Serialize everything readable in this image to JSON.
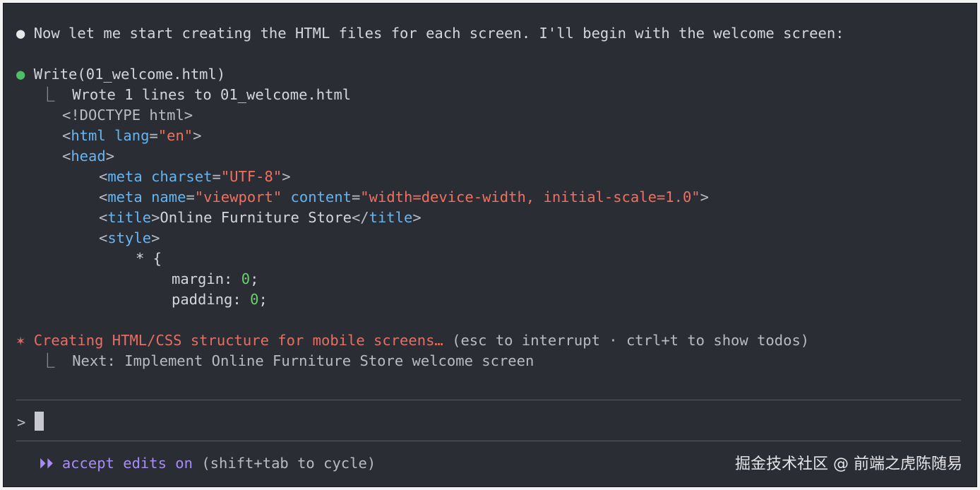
{
  "messages": {
    "intro_bullet": "●",
    "intro_text": "Now let me start creating the HTML files for each screen. I'll begin with the welcome screen:",
    "tool_bullet": "●",
    "tool_call": "Write(01_welcome.html)",
    "result_branch": "⎿",
    "result_text": "Wrote 1 lines to 01_welcome.html"
  },
  "code": {
    "doctype": "<!DOCTYPE html>",
    "html_open": "<",
    "html_tag": "html",
    "html_attr": "lang",
    "html_eq": "=",
    "html_val": "\"en\"",
    "html_close": ">",
    "head_open": "<",
    "head_tag": "head",
    "head_close": ">",
    "meta1_open": "<",
    "meta1_tag": "meta",
    "meta1_attr": "charset",
    "meta1_eq": "=",
    "meta1_val": "\"UTF-8\"",
    "meta1_close": ">",
    "meta2_open": "<",
    "meta2_tag": "meta",
    "meta2_attr1": "name",
    "meta2_eq1": "=",
    "meta2_val1": "\"viewport\"",
    "meta2_attr2": "content",
    "meta2_eq2": "=",
    "meta2_val2": "\"width=device-width, initial-scale=1.0\"",
    "meta2_close": ">",
    "title_open": "<",
    "title_tag": "title",
    "title_close": ">",
    "title_text": "Online Furniture Store",
    "title_end_open": "</",
    "title_end_tag": "title",
    "title_end_close": ">",
    "style_open": "<",
    "style_tag": "style",
    "style_close": ">",
    "selector": "* {",
    "margin_prop": "margin: ",
    "margin_val": "0",
    "margin_semi": ";",
    "padding_prop": "padding: ",
    "padding_val": "0",
    "padding_semi": ";"
  },
  "status": {
    "spinner": "✶",
    "text": "Creating HTML/CSS structure for mobile screens…",
    "hint": "(esc to interrupt · ctrl+t to show todos)",
    "next_branch": "⎿",
    "next_text": "Next: Implement Online Furniture Store welcome screen"
  },
  "input": {
    "prompt_symbol": ">"
  },
  "footer": {
    "mode_icon": "⏵⏵",
    "mode_label": "accept edits on",
    "mode_hint": "(shift+tab to cycle)",
    "watermark": "掘金技术社区 @ 前端之虎陈随易"
  },
  "colors": {
    "background": "#2b2d35",
    "tag": "#67b6f0",
    "string": "#f07060",
    "number": "#6ccf6c",
    "status": "#e56f63",
    "mode": "#a98cf5",
    "bullet_green": "#4fbf66"
  }
}
